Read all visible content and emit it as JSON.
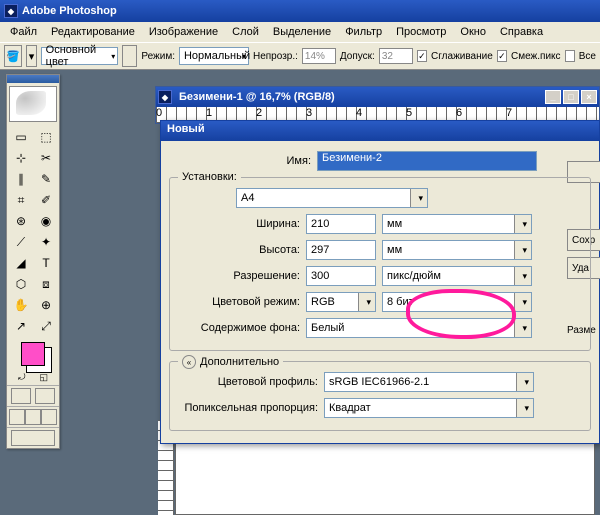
{
  "app": {
    "title": "Adobe Photoshop"
  },
  "menu": [
    "Файл",
    "Редактирование",
    "Изображение",
    "Слой",
    "Выделение",
    "Фильтр",
    "Просмотр",
    "Окно",
    "Справка"
  ],
  "options": {
    "foreground": "Основной цвет",
    "mode_label": "Режим:",
    "mode_value": "Нормальный",
    "opacity_label": "Непрозр.:",
    "opacity_value": "14%",
    "tolerance_label": "Допуск:",
    "tolerance_value": "32",
    "antialias": "Сглаживание",
    "contiguous": "Смеж.пикс",
    "alllayers": "Все"
  },
  "doc": {
    "title": "Безимени-1 @ 16,7% (RGB/8)"
  },
  "dialog": {
    "title": "Новый",
    "name_label": "Имя:",
    "name_value": "Безимени-2",
    "preset_label": "Установки:",
    "preset_value": "A4",
    "width_label": "Ширина:",
    "width_value": "210",
    "width_unit": "мм",
    "height_label": "Высота:",
    "height_value": "297",
    "height_unit": "мм",
    "res_label": "Разрешение:",
    "res_value": "300",
    "res_unit": "пикс/дюйм",
    "mode_label": "Цветовой режим:",
    "mode_value": "RGB",
    "depth_value": "8 бит",
    "bg_label": "Содержимое фона:",
    "bg_value": "Белый",
    "advanced": "Дополнительно",
    "profile_label": "Цветовой профиль:",
    "profile_value": "sRGB IEC61966-2.1",
    "pixel_label": "Попиксельная пропорция:",
    "pixel_value": "Квадрат",
    "save_btn": "Сохр",
    "del_btn": "Уда",
    "size_label": "Разме"
  },
  "tools": [
    "▭",
    "⬚",
    "⊹",
    "✂",
    "∥",
    "✎",
    "⌗",
    "✐",
    "⊛",
    "◉",
    "⟋",
    "✦",
    "◢",
    "T",
    "⬡",
    "⧈",
    "✋",
    "⊕",
    "↗",
    "⤢"
  ],
  "swatch_color": "#ff4ec8"
}
